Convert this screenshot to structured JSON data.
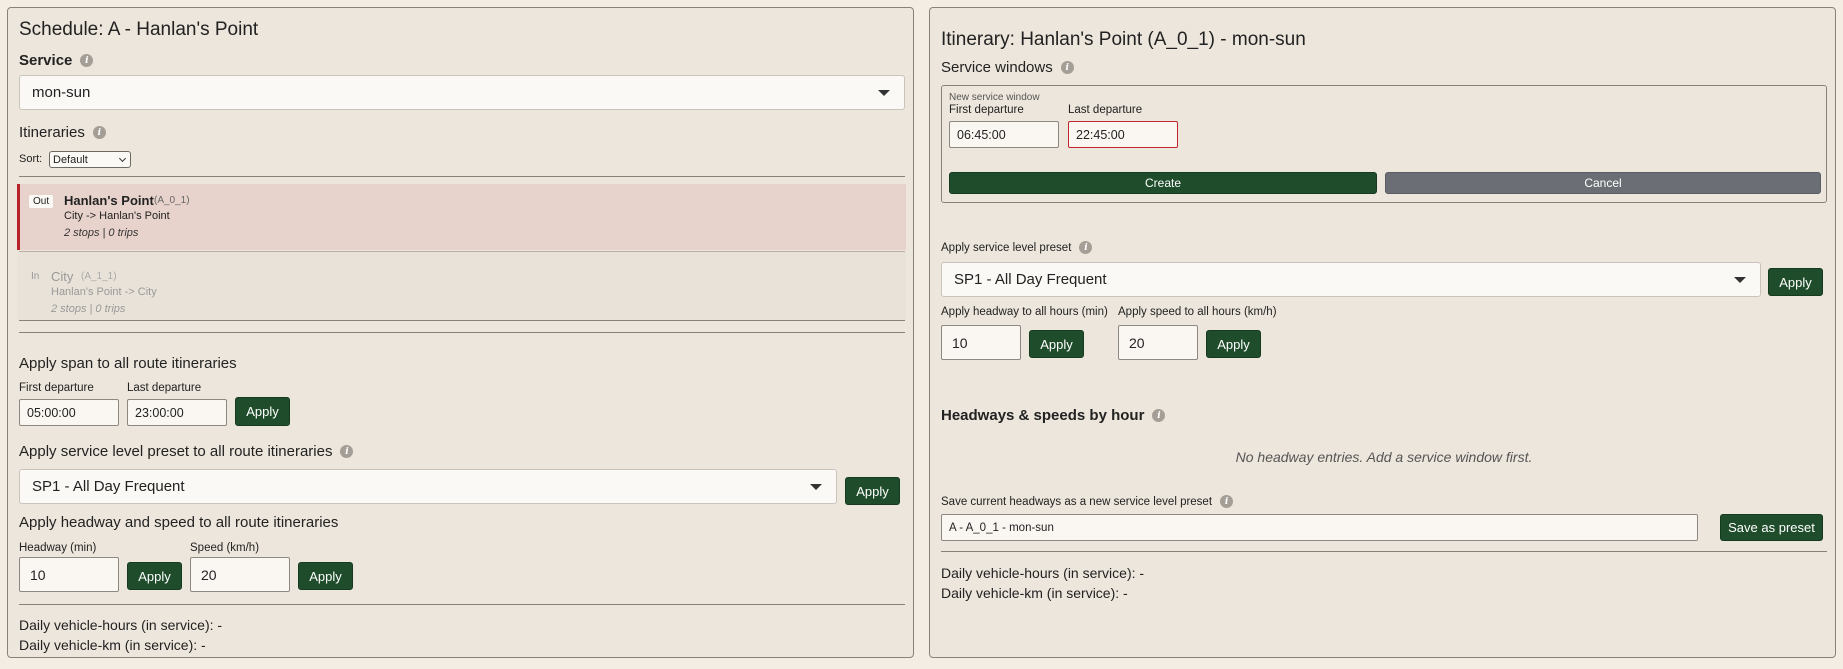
{
  "left": {
    "title": "Schedule: A - Hanlan's Point",
    "service": {
      "label": "Service",
      "value": "mon-sun"
    },
    "itineraries": {
      "label": "Itineraries",
      "sort_label": "Sort:",
      "sort_value": "Default",
      "items": [
        {
          "dir": "Out",
          "name": "Hanlan's Point",
          "code": "(A_0_1)",
          "route": "City -> Hanlan's Point",
          "meta": "2 stops | 0 trips"
        },
        {
          "dir": "In",
          "name": "City",
          "code": "(A_1_1)",
          "route": "Hanlan's Point -> City",
          "meta": "2 stops | 0 trips"
        }
      ]
    },
    "span": {
      "title": "Apply span to all route itineraries",
      "first_label": "First departure",
      "first_value": "05:00:00",
      "last_label": "Last departure",
      "last_value": "23:00:00",
      "apply": "Apply"
    },
    "preset": {
      "title": "Apply service level preset to all route itineraries",
      "value": "SP1 - All Day Frequent",
      "apply": "Apply"
    },
    "headway_speed": {
      "title": "Apply headway and speed to all route itineraries",
      "headway_label": "Headway (min)",
      "headway_value": "10",
      "speed_label": "Speed (km/h)",
      "speed_value": "20",
      "apply": "Apply"
    },
    "stats": {
      "hours": "Daily vehicle-hours (in service): -",
      "km": "Daily vehicle-km (in service): -"
    }
  },
  "right": {
    "title": "Itinerary: Hanlan's Point (A_0_1) - mon-sun",
    "windows": {
      "label": "Service windows",
      "legend": "New service window",
      "first_label": "First departure",
      "first_value": "06:45:00",
      "last_label": "Last departure",
      "last_value": "22:45:00",
      "create": "Create",
      "cancel": "Cancel"
    },
    "preset": {
      "label": "Apply service level preset",
      "value": "SP1 - All Day Frequent",
      "apply": "Apply"
    },
    "headway": {
      "label": "Apply headway to all hours (min)",
      "value": "10",
      "apply": "Apply"
    },
    "speed": {
      "label": "Apply speed to all hours (km/h)",
      "value": "20",
      "apply": "Apply"
    },
    "hourly": {
      "label": "Headways & speeds by hour",
      "empty": "No headway entries. Add a service window first."
    },
    "save": {
      "label": "Save current headways as a new service level preset",
      "value": "A - A_0_1 - mon-sun",
      "button": "Save as preset"
    },
    "stats": {
      "hours": "Daily vehicle-hours (in service): -",
      "km": "Daily vehicle-km (in service): -"
    }
  },
  "colors": {
    "accent": "#1f4d2b",
    "selected_row": "#e8d3cc",
    "selected_bar": "#b8222a",
    "error": "#c0262d"
  }
}
